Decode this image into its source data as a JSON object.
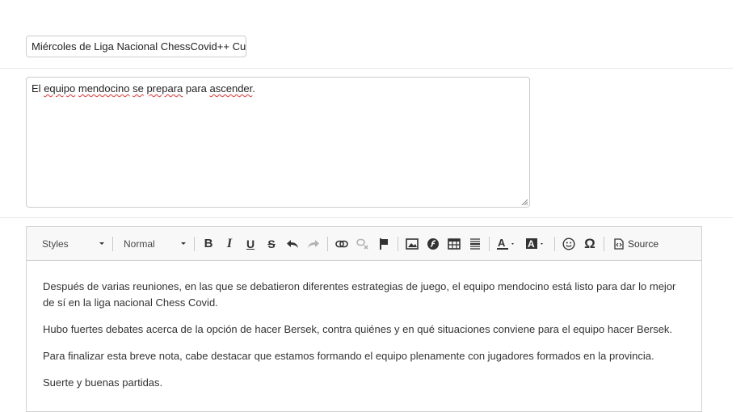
{
  "title_input": {
    "value": "Miércoles de Liga Nacional ChessCovid++ Cu"
  },
  "summary": {
    "words": [
      "El",
      " ",
      "equipo",
      " ",
      "mendocino",
      " ",
      "se",
      " ",
      "prepara",
      " para ",
      "ascender",
      "."
    ]
  },
  "toolbar": {
    "styles_label": "Styles",
    "format_label": "Normal",
    "source_label": "Source"
  },
  "content": {
    "paragraphs": [
      "Después de varias reuniones, en las que se debatieron diferentes estrategias de juego, el equipo mendocino está listo para dar lo mejor de sí en la liga nacional Chess Covid.",
      "Hubo fuertes debates acerca de la opción de hacer Bersek, contra quiénes y en qué situaciones conviene para el equipo hacer Bersek.",
      "Para finalizar esta breve nota, cabe destacar que estamos formando el equipo plenamente con jugadores formados en la provincia.",
      "Suerte y buenas partidas."
    ]
  }
}
